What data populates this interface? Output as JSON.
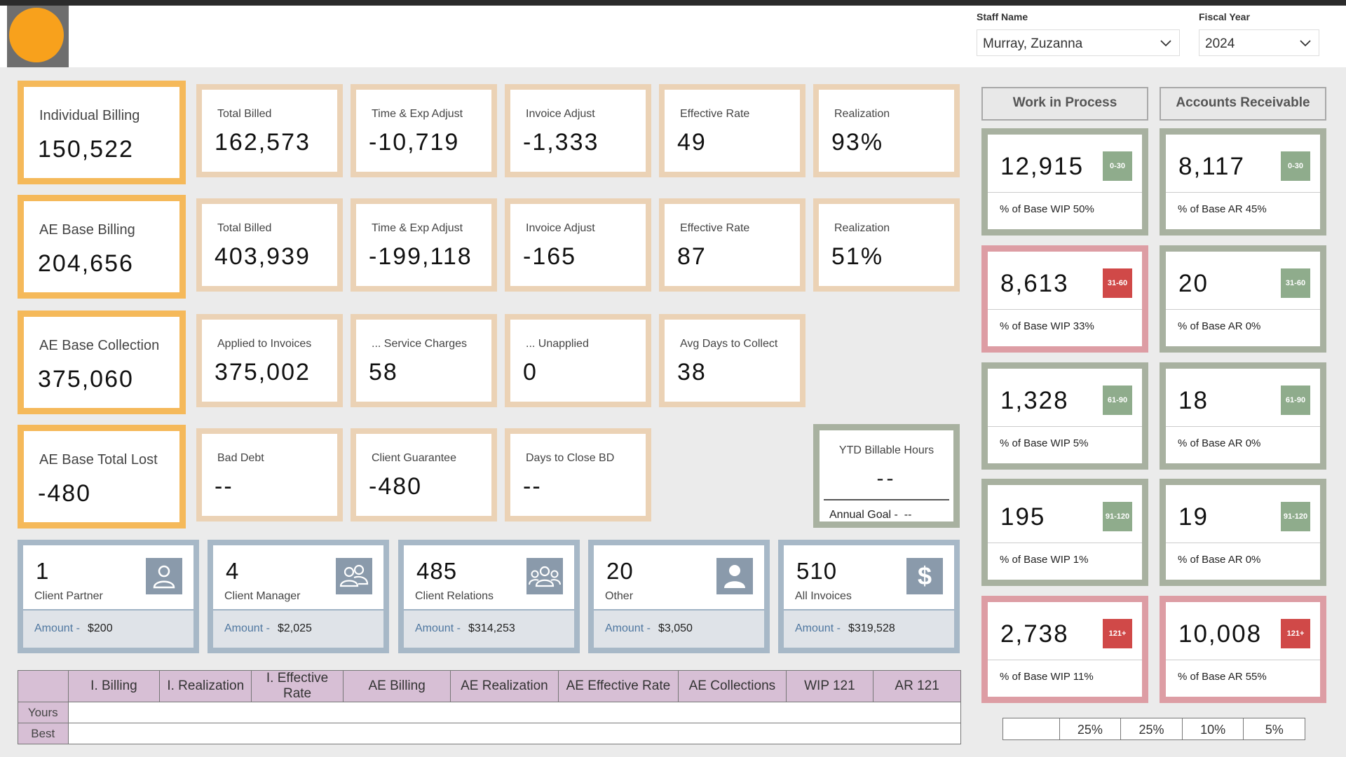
{
  "filters": {
    "staff_label": "Staff Name",
    "staff_value": "Murray, Zuzanna",
    "year_label": "Fiscal Year",
    "year_value": "2024"
  },
  "rows": [
    {
      "main": {
        "title": "Individual Billing",
        "value": "150,522"
      },
      "cards": [
        {
          "title": "Total Billed",
          "value": "162,573"
        },
        {
          "title": "Time & Exp Adjust",
          "value": "-10,719"
        },
        {
          "title": "Invoice Adjust",
          "value": "-1,333"
        },
        {
          "title": "Effective Rate",
          "value": "49"
        },
        {
          "title": "Realization",
          "value": "93%"
        }
      ]
    },
    {
      "main": {
        "title": "AE Base Billing",
        "value": "204,656"
      },
      "cards": [
        {
          "title": "Total Billed",
          "value": "403,939"
        },
        {
          "title": "Time & Exp Adjust",
          "value": "-199,118"
        },
        {
          "title": "Invoice Adjust",
          "value": "-165"
        },
        {
          "title": "Effective Rate",
          "value": "87"
        },
        {
          "title": "Realization",
          "value": "51%"
        }
      ]
    },
    {
      "main": {
        "title": "AE Base Collection",
        "value": "375,060"
      },
      "cards": [
        {
          "title": "Applied to Invoices",
          "value": "375,002"
        },
        {
          "title": "... Service Charges",
          "value": "58"
        },
        {
          "title": "... Unapplied",
          "value": "0"
        },
        {
          "title": "Avg Days to Collect",
          "value": "38"
        }
      ]
    },
    {
      "main": {
        "title": "AE Base Total Lost",
        "value": "-480"
      },
      "cards": [
        {
          "title": "Bad Debt",
          "value": "--"
        },
        {
          "title": "Client Guarantee",
          "value": "-480"
        },
        {
          "title": "Days to Close BD",
          "value": "--"
        }
      ]
    }
  ],
  "ytd": {
    "title": "YTD Billable Hours",
    "value": "--",
    "goal_label": "Annual Goal -",
    "goal_value": "--"
  },
  "wip_header": "Work in Process",
  "ar_header": "Accounts Receivable",
  "aging": [
    {
      "badge": "0-30",
      "color": "#8fac8c",
      "wip": "12,915",
      "wip_pct": "% of Base WIP 50%",
      "wip_border": "green",
      "ar": "8,117",
      "ar_pct": "% of Base AR 45%",
      "ar_border": "green",
      "ar_badge_color": "#8fac8c"
    },
    {
      "badge": "31-60",
      "color": "#d04948",
      "wip": "8,613",
      "wip_pct": "% of Base WIP 33%",
      "wip_border": "red",
      "ar": "20",
      "ar_pct": "% of Base AR 0%",
      "ar_border": "green",
      "ar_badge_color": "#8fac8c"
    },
    {
      "badge": "61-90",
      "color": "#8fac8c",
      "wip": "1,328",
      "wip_pct": "% of Base WIP 5%",
      "wip_border": "green",
      "ar": "18",
      "ar_pct": "% of Base AR 0%",
      "ar_border": "green",
      "ar_badge_color": "#8fac8c"
    },
    {
      "badge": "91-120",
      "color": "#8fac8c",
      "wip": "195",
      "wip_pct": "% of Base WIP 1%",
      "wip_border": "green",
      "ar": "19",
      "ar_pct": "% of Base AR 0%",
      "ar_border": "green",
      "ar_badge_color": "#8fac8c"
    },
    {
      "badge": "121+",
      "color": "#d04948",
      "wip": "2,738",
      "wip_pct": "% of Base WIP 11%",
      "wip_border": "red",
      "ar": "10,008",
      "ar_pct": "% of Base AR 55%",
      "ar_border": "red",
      "ar_badge_color": "#d04948"
    }
  ],
  "percent_bar": [
    "",
    "25%",
    "25%",
    "10%",
    "5%"
  ],
  "people": [
    {
      "count": "1",
      "role": "Client Partner",
      "amount_label": "Amount -",
      "amount": "$200",
      "icon": "person-outline-icon"
    },
    {
      "count": "4",
      "role": "Client Manager",
      "amount_label": "Amount -",
      "amount": "$2,025",
      "icon": "two-people-icon"
    },
    {
      "count": "485",
      "role": "Client Relations",
      "amount_label": "Amount -",
      "amount": "$314,253",
      "icon": "group-icon"
    },
    {
      "count": "20",
      "role": "Other",
      "amount_label": "Amount -",
      "amount": "$3,050",
      "icon": "person-solid-icon"
    },
    {
      "count": "510",
      "role": "All Invoices",
      "amount_label": "Amount -",
      "amount": "$319,528",
      "icon": "dollar-icon"
    }
  ],
  "table": {
    "headers": [
      "",
      "I. Billing",
      "I. Realization",
      "I. Effective Rate",
      "AE Billing",
      "AE Realization",
      "AE Effective Rate",
      "AE Collections",
      "WIP 121",
      "AR 121"
    ],
    "rows": [
      "Yours",
      "Best"
    ]
  }
}
